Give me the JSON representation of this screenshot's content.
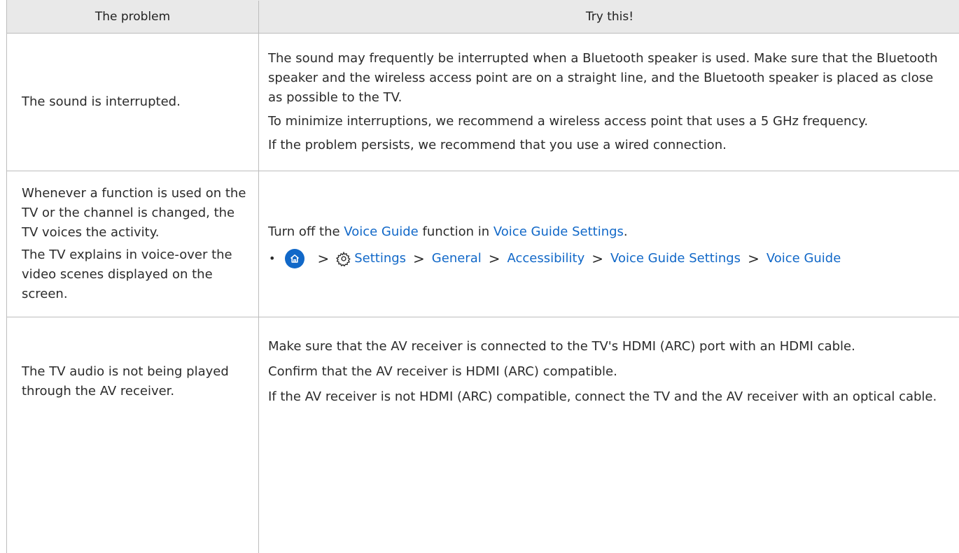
{
  "header": {
    "col1": "The problem",
    "col2": "Try this!"
  },
  "rows": [
    {
      "problem": [
        "The sound is interrupted."
      ],
      "solutions": [
        "The sound may frequently be interrupted when a Bluetooth speaker is used. Make sure that the Bluetooth speaker and the wireless access point are on a straight line, and the Bluetooth speaker is placed as close as possible to the TV.",
        "To minimize interruptions, we recommend a wireless access point that uses a 5 GHz frequency.",
        "If the problem persists, we recommend that you use a wired connection."
      ]
    },
    {
      "problem": [
        "Whenever a function is used on the TV or the channel is changed, the TV voices the activity.",
        "The TV explains in voice-over the video scenes displayed on the screen."
      ],
      "solution_prefix": "Turn off the ",
      "solution_link1": "Voice Guide",
      "solution_mid": " function in ",
      "solution_link2": "Voice Guide Settings",
      "solution_suffix": ".",
      "path": {
        "bullet": "•",
        "separator": ">",
        "items": [
          "Settings",
          "General",
          "Accessibility",
          "Voice Guide Settings",
          "Voice Guide"
        ]
      }
    },
    {
      "problem": [
        "The TV audio is not being played through the AV receiver."
      ],
      "solutions": [
        "Make sure that the AV receiver is connected to the TV's HDMI (ARC) port with an HDMI cable.",
        "Confirm that the AV receiver is HDMI (ARC) compatible.",
        "If the AV receiver is not HDMI (ARC) compatible, connect the TV and the AV receiver with an optical cable."
      ]
    }
  ],
  "colors": {
    "link": "#1168c8",
    "header_bg": "#e9e9e9",
    "border": "#bdbdbd"
  },
  "icons": {
    "home": "home-icon",
    "settings": "gear-icon",
    "chevron": "chevron-right-icon"
  }
}
